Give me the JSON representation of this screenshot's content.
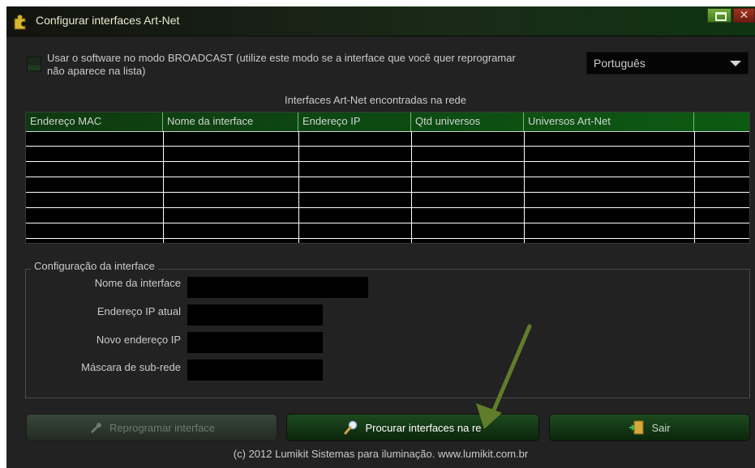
{
  "window": {
    "title": "Configurar interfaces Art-Net"
  },
  "broadcast": {
    "label_line1": "Usar o software no modo BROADCAST (utilize este modo se a interface que você quer reprogramar",
    "label_line2": "não aparece na lista)",
    "checked": false
  },
  "language": {
    "selected": "Português"
  },
  "interfaces_table": {
    "caption": "Interfaces Art-Net encontradas na rede",
    "columns": [
      "Endereço MAC",
      "Nome da interface",
      "Endereço IP",
      "Qtd universos",
      "Universos Art-Net",
      ""
    ],
    "rows": []
  },
  "config": {
    "group_title": "Configuração da interface",
    "fields": [
      {
        "label": "Nome da interface",
        "value": ""
      },
      {
        "label": "Endereço IP atual",
        "value": ""
      },
      {
        "label": "Novo endereço IP",
        "value": ""
      },
      {
        "label": "Máscara de sub-rede",
        "value": ""
      }
    ]
  },
  "buttons": {
    "reprogram": "Reprogramar interface",
    "search": "Procurar interfaces na re",
    "exit": "Sair"
  },
  "footer": "(c) 2012 Lumikit Sistemas para iluminação. www.lumikit.com.br",
  "colors": {
    "window_bg": "#222222",
    "table_header": "#0d4a12",
    "annotation_arrow": "#5f7d2a"
  },
  "icons": {
    "title": "puzzle-icon",
    "reprogram": "wrench-icon",
    "search": "magnifier-icon",
    "exit": "exit-door-icon"
  }
}
